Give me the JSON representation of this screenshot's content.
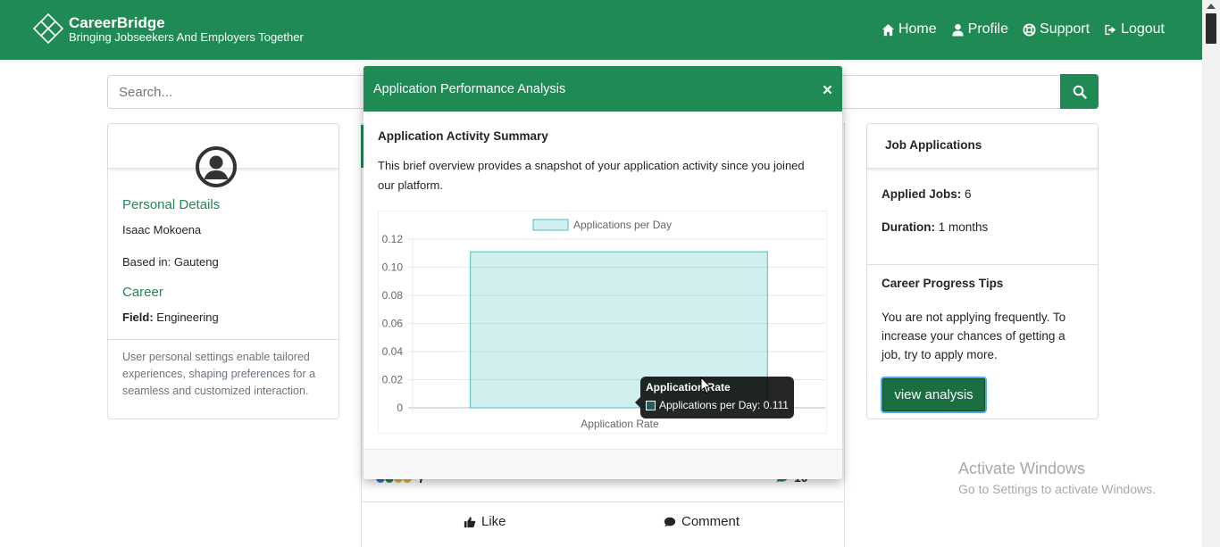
{
  "navbar": {
    "brand_name": "CareerBridge",
    "brand_tagline": "Bringing Jobseekers And Employers Together",
    "links": {
      "home": "Home",
      "profile": "Profile",
      "support": "Support",
      "logout": "Logout"
    },
    "color": "#1f8a53"
  },
  "search": {
    "placeholder": "Search..."
  },
  "profile_card": {
    "personal_heading": "Personal Details",
    "name": "Isaac Mokoena",
    "location_label": "Based in:",
    "location_value": "Gauteng",
    "career_heading": "Career",
    "field_label": "Field:",
    "field_value": "Engineering",
    "footer_note": "User personal settings enable tailored experiences, shaping preferences for a seamless and customized interaction."
  },
  "feed": {
    "reaction_count": "7",
    "comment_count": "10",
    "like_label": "Like",
    "comment_label": "Comment"
  },
  "applications_card": {
    "title": "Job Applications",
    "applied_label": "Applied Jobs:",
    "applied_value": "6",
    "duration_label": "Duration:",
    "duration_value": "1 months",
    "tips_title": "Career Progress Tips",
    "tips_text": "You are not applying frequently. To increase your chances of getting a job, try to apply more.",
    "button_label": "view analysis"
  },
  "modal": {
    "title": "Application Performance Analysis",
    "close_symbol": "×",
    "subtitle": "Application Activity Summary",
    "description": "This brief overview provides a snapshot of your application activity since you joined our platform.",
    "tooltip": {
      "title": "Application Rate",
      "label": "Applications per Day: 0.111"
    }
  },
  "chart_data": {
    "type": "bar",
    "categories": [
      "Application Rate"
    ],
    "series": [
      {
        "name": "Applications per Day",
        "values": [
          0.111
        ],
        "color": "rgba(75,192,192,0.25)",
        "border": "#4bc0c0"
      }
    ],
    "y_ticks": [
      "0",
      "0.02",
      "0.04",
      "0.06",
      "0.08",
      "0.10",
      "0.12"
    ],
    "ylim": [
      0,
      0.12
    ],
    "legend": "top",
    "grid": true
  },
  "watermark": {
    "title": "Activate Windows",
    "subtitle": "Go to Settings to activate Windows."
  }
}
